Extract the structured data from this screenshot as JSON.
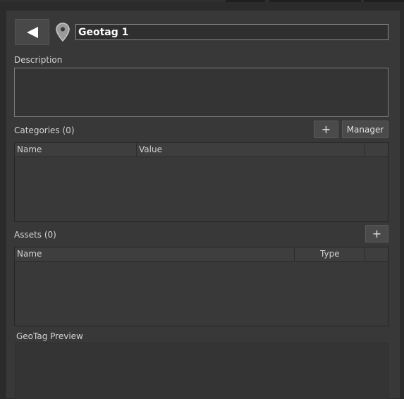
{
  "header": {
    "title_value": "Geotag 1",
    "back_icon": "back-arrow-icon",
    "location_icon": "location-pin-icon"
  },
  "description": {
    "label": "Description",
    "value": ""
  },
  "categories": {
    "label": "Categories (0)",
    "add_label": "+",
    "manager_label": "Manager",
    "columns": [
      "Name",
      "Value"
    ],
    "rows": []
  },
  "assets": {
    "label": "Assets (0)",
    "add_label": "+",
    "columns": [
      "Name",
      "Type"
    ],
    "rows": []
  },
  "preview": {
    "label": "GeoTag Preview"
  },
  "colors": {
    "panel": "#383838",
    "background": "#2b2b2b",
    "text": "#d8d8d8"
  }
}
